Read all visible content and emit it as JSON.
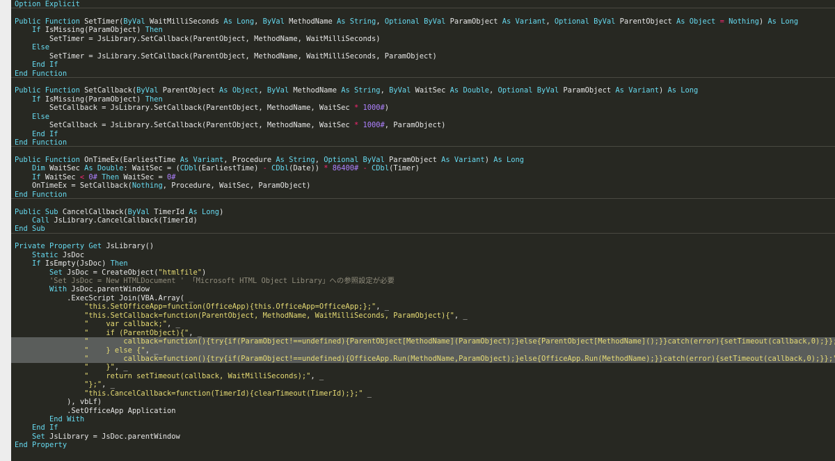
{
  "editor": {
    "colors": {
      "background": "#272822",
      "gutter": "#ededed",
      "keyword": "#66d9ef",
      "identifier": "#e6e6e6",
      "string": "#e6db74",
      "number": "#ae81ff",
      "operator": "#f92672",
      "comment": "#8f8b7b",
      "selection": "#5a5d5b"
    },
    "lines": [
      {
        "sep": true,
        "tokens": [
          [
            "kw",
            "Option Explicit"
          ]
        ]
      },
      {
        "tokens": []
      },
      {
        "tokens": [
          [
            "kw",
            "Public Function "
          ],
          [
            "id",
            "SetTimer("
          ],
          [
            "kw",
            "ByVal "
          ],
          [
            "id",
            "WaitMilliSeconds "
          ],
          [
            "kw",
            "As Long"
          ],
          [
            "id",
            ", "
          ],
          [
            "kw",
            "ByVal "
          ],
          [
            "id",
            "MethodName "
          ],
          [
            "kw",
            "As String"
          ],
          [
            "id",
            ", "
          ],
          [
            "kw",
            "Optional ByVal "
          ],
          [
            "id",
            "ParamObject "
          ],
          [
            "kw",
            "As Variant"
          ],
          [
            "id",
            ", "
          ],
          [
            "kw",
            "Optional ByVal "
          ],
          [
            "id",
            "ParentObject "
          ],
          [
            "kw",
            "As Object "
          ],
          [
            "op",
            "= "
          ],
          [
            "kw",
            "Nothing"
          ],
          [
            "id",
            ") "
          ],
          [
            "kw",
            "As Long"
          ]
        ]
      },
      {
        "tokens": [
          [
            "pl",
            "    "
          ],
          [
            "kw",
            "If "
          ],
          [
            "id",
            "IsMissing(ParamObject) "
          ],
          [
            "kw",
            "Then"
          ]
        ]
      },
      {
        "tokens": [
          [
            "pl",
            "        "
          ],
          [
            "id",
            "SetTimer = JsLibrary.SetCallback(ParentObject, MethodName, WaitMilliSeconds)"
          ]
        ]
      },
      {
        "tokens": [
          [
            "pl",
            "    "
          ],
          [
            "kw",
            "Else"
          ]
        ]
      },
      {
        "tokens": [
          [
            "pl",
            "        "
          ],
          [
            "id",
            "SetTimer = JsLibrary.SetCallback(ParentObject, MethodName, WaitMilliSeconds, ParamObject)"
          ]
        ]
      },
      {
        "tokens": [
          [
            "pl",
            "    "
          ],
          [
            "kw",
            "End If"
          ]
        ]
      },
      {
        "sep": true,
        "tokens": [
          [
            "kw",
            "End Function"
          ]
        ]
      },
      {
        "tokens": []
      },
      {
        "tokens": [
          [
            "kw",
            "Public Function "
          ],
          [
            "id",
            "SetCallback("
          ],
          [
            "kw",
            "ByVal "
          ],
          [
            "id",
            "ParentObject "
          ],
          [
            "kw",
            "As Object"
          ],
          [
            "id",
            ", "
          ],
          [
            "kw",
            "ByVal "
          ],
          [
            "id",
            "MethodName "
          ],
          [
            "kw",
            "As String"
          ],
          [
            "id",
            ", "
          ],
          [
            "kw",
            "ByVal "
          ],
          [
            "id",
            "WaitSec "
          ],
          [
            "kw",
            "As Double"
          ],
          [
            "id",
            ", "
          ],
          [
            "kw",
            "Optional ByVal "
          ],
          [
            "id",
            "ParamObject "
          ],
          [
            "kw",
            "As Variant"
          ],
          [
            "id",
            ") "
          ],
          [
            "kw",
            "As Long"
          ]
        ]
      },
      {
        "tokens": [
          [
            "pl",
            "    "
          ],
          [
            "kw",
            "If "
          ],
          [
            "id",
            "IsMissing(ParamObject) "
          ],
          [
            "kw",
            "Then"
          ]
        ]
      },
      {
        "tokens": [
          [
            "pl",
            "        "
          ],
          [
            "id",
            "SetCallback = JsLibrary.SetCallback(ParentObject, MethodName, WaitSec "
          ],
          [
            "op",
            "* "
          ],
          [
            "num",
            "1000#"
          ],
          [
            "id",
            ")"
          ]
        ]
      },
      {
        "tokens": [
          [
            "pl",
            "    "
          ],
          [
            "kw",
            "Else"
          ]
        ]
      },
      {
        "tokens": [
          [
            "pl",
            "        "
          ],
          [
            "id",
            "SetCallback = JsLibrary.SetCallback(ParentObject, MethodName, WaitSec "
          ],
          [
            "op",
            "* "
          ],
          [
            "num",
            "1000#"
          ],
          [
            "id",
            ", ParamObject)"
          ]
        ]
      },
      {
        "tokens": [
          [
            "pl",
            "    "
          ],
          [
            "kw",
            "End If"
          ]
        ]
      },
      {
        "sep": true,
        "tokens": [
          [
            "kw",
            "End Function"
          ]
        ]
      },
      {
        "tokens": []
      },
      {
        "tokens": [
          [
            "kw",
            "Public Function "
          ],
          [
            "id",
            "OnTimeEx(EarliestTime "
          ],
          [
            "kw",
            "As Variant"
          ],
          [
            "id",
            ", Procedure "
          ],
          [
            "kw",
            "As String"
          ],
          [
            "id",
            ", "
          ],
          [
            "kw",
            "Optional ByVal "
          ],
          [
            "id",
            "ParamObject "
          ],
          [
            "kw",
            "As Variant"
          ],
          [
            "id",
            ") "
          ],
          [
            "kw",
            "As Long"
          ]
        ]
      },
      {
        "tokens": [
          [
            "pl",
            "    "
          ],
          [
            "kw",
            "Dim "
          ],
          [
            "id",
            "WaitSec "
          ],
          [
            "kw",
            "As Double"
          ],
          [
            "id",
            ": WaitSec = ("
          ],
          [
            "kw",
            "CDbl"
          ],
          [
            "id",
            "(EarliestTime) "
          ],
          [
            "op",
            "- "
          ],
          [
            "kw",
            "CDbl"
          ],
          [
            "id",
            "(Date)) "
          ],
          [
            "op",
            "* "
          ],
          [
            "num",
            "86400# "
          ],
          [
            "op",
            "- "
          ],
          [
            "kw",
            "CDbl"
          ],
          [
            "id",
            "(Timer)"
          ]
        ]
      },
      {
        "tokens": [
          [
            "pl",
            "    "
          ],
          [
            "kw",
            "If "
          ],
          [
            "id",
            "WaitSec "
          ],
          [
            "op",
            "< "
          ],
          [
            "num",
            "0# "
          ],
          [
            "kw",
            "Then "
          ],
          [
            "id",
            "WaitSec = "
          ],
          [
            "num",
            "0#"
          ]
        ]
      },
      {
        "tokens": [
          [
            "pl",
            "    "
          ],
          [
            "id",
            "OnTimeEx = SetCallback("
          ],
          [
            "kw",
            "Nothing"
          ],
          [
            "id",
            ", Procedure, WaitSec, ParamObject)"
          ]
        ]
      },
      {
        "sep": true,
        "tokens": [
          [
            "kw",
            "End Function"
          ]
        ]
      },
      {
        "tokens": []
      },
      {
        "tokens": [
          [
            "kw",
            "Public Sub "
          ],
          [
            "id",
            "CancelCallback("
          ],
          [
            "kw",
            "ByVal "
          ],
          [
            "id",
            "TimerId "
          ],
          [
            "kw",
            "As Long"
          ],
          [
            "id",
            ")"
          ]
        ]
      },
      {
        "tokens": [
          [
            "pl",
            "    "
          ],
          [
            "kw",
            "Call "
          ],
          [
            "id",
            "JsLibrary.CancelCallback(TimerId)"
          ]
        ]
      },
      {
        "sep": true,
        "tokens": [
          [
            "kw",
            "End Sub"
          ]
        ]
      },
      {
        "tokens": []
      },
      {
        "tokens": [
          [
            "kw",
            "Private Property Get "
          ],
          [
            "id",
            "JsLibrary()"
          ]
        ]
      },
      {
        "tokens": [
          [
            "pl",
            "    "
          ],
          [
            "kw",
            "Static "
          ],
          [
            "id",
            "JsDoc"
          ]
        ]
      },
      {
        "tokens": [
          [
            "pl",
            "    "
          ],
          [
            "kw",
            "If "
          ],
          [
            "id",
            "IsEmpty(JsDoc) "
          ],
          [
            "kw",
            "Then"
          ]
        ]
      },
      {
        "tokens": [
          [
            "pl",
            "        "
          ],
          [
            "kw",
            "Set "
          ],
          [
            "id",
            "JsDoc = CreateObject("
          ],
          [
            "str",
            "\"htmlfile\""
          ],
          [
            "id",
            ")"
          ]
        ]
      },
      {
        "tokens": [
          [
            "pl",
            "        "
          ],
          [
            "cm",
            "'Set JsDoc = New HTMLDocument ' 「Microsoft HTML Object Library」への参照設定が必要"
          ]
        ]
      },
      {
        "tokens": [
          [
            "pl",
            "        "
          ],
          [
            "kw",
            "With "
          ],
          [
            "id",
            "JsDoc.parentWindow"
          ]
        ]
      },
      {
        "tokens": [
          [
            "pl",
            "            "
          ],
          [
            "id",
            ".ExecScript Join(VBA.Array( _"
          ]
        ]
      },
      {
        "tokens": [
          [
            "pl",
            "                "
          ],
          [
            "str",
            "\"this.SetOfficeApp=function(OfficeApp){this.OfficeApp=OfficeApp;};\""
          ],
          [
            "id",
            ", _"
          ]
        ]
      },
      {
        "tokens": [
          [
            "pl",
            "                "
          ],
          [
            "str",
            "\"this.SetCallback=function(ParentObject, MethodName, WaitMilliSeconds, ParamObject){\""
          ],
          [
            "id",
            ", _"
          ]
        ]
      },
      {
        "tokens": [
          [
            "pl",
            "                "
          ],
          [
            "str",
            "\"    var callback;\""
          ],
          [
            "id",
            ", _"
          ]
        ]
      },
      {
        "tokens": [
          [
            "pl",
            "                "
          ],
          [
            "str",
            "\"    if (ParentObject){\""
          ],
          [
            "id",
            ", _"
          ]
        ]
      },
      {
        "sel": true,
        "tokens": [
          [
            "pl",
            "                "
          ],
          [
            "str",
            "\"        callback=function(){try{if(ParamObject!==undefined){ParentObject[MethodName](ParamObject);}else{ParentObject[MethodName]();}}catch(error){setTimeout(callback,0);}};\""
          ],
          [
            "id",
            ", _"
          ]
        ]
      },
      {
        "sel": true,
        "tokens": [
          [
            "pl",
            "                "
          ],
          [
            "str",
            "\"    } else {\""
          ],
          [
            "id",
            ", _"
          ]
        ]
      },
      {
        "sel": true,
        "tokens": [
          [
            "pl",
            "                "
          ],
          [
            "str",
            "\"        callback=function(){try{if(ParamObject!==undefined){OfficeApp.Run(MethodName,ParamObject);}else{OfficeApp.Run(MethodName);}}catch(error){setTimeout(callback,0);}};\""
          ],
          [
            "id",
            ", _"
          ]
        ]
      },
      {
        "tokens": [
          [
            "pl",
            "                "
          ],
          [
            "str",
            "\"    }\""
          ],
          [
            "id",
            ", _"
          ]
        ]
      },
      {
        "tokens": [
          [
            "pl",
            "                "
          ],
          [
            "str",
            "\"    return setTimeout(callback, WaitMilliSeconds);\""
          ],
          [
            "id",
            ", _"
          ]
        ]
      },
      {
        "tokens": [
          [
            "pl",
            "                "
          ],
          [
            "str",
            "\"};\""
          ],
          [
            "id",
            ", _"
          ]
        ]
      },
      {
        "tokens": [
          [
            "pl",
            "                "
          ],
          [
            "str",
            "\"this.CancelCallback=function(TimerId){clearTimeout(TimerId);};\""
          ],
          [
            "id",
            " _"
          ]
        ]
      },
      {
        "tokens": [
          [
            "pl",
            "            "
          ],
          [
            "id",
            "), vbLf)"
          ]
        ]
      },
      {
        "tokens": [
          [
            "pl",
            "            "
          ],
          [
            "id",
            ".SetOfficeApp Application"
          ]
        ]
      },
      {
        "tokens": [
          [
            "pl",
            "        "
          ],
          [
            "kw",
            "End With"
          ]
        ]
      },
      {
        "tokens": [
          [
            "pl",
            "    "
          ],
          [
            "kw",
            "End If"
          ]
        ]
      },
      {
        "tokens": [
          [
            "pl",
            "    "
          ],
          [
            "kw",
            "Set "
          ],
          [
            "id",
            "JsLibrary = JsDoc.parentWindow"
          ]
        ]
      },
      {
        "tokens": [
          [
            "kw",
            "End Property"
          ]
        ]
      }
    ]
  }
}
